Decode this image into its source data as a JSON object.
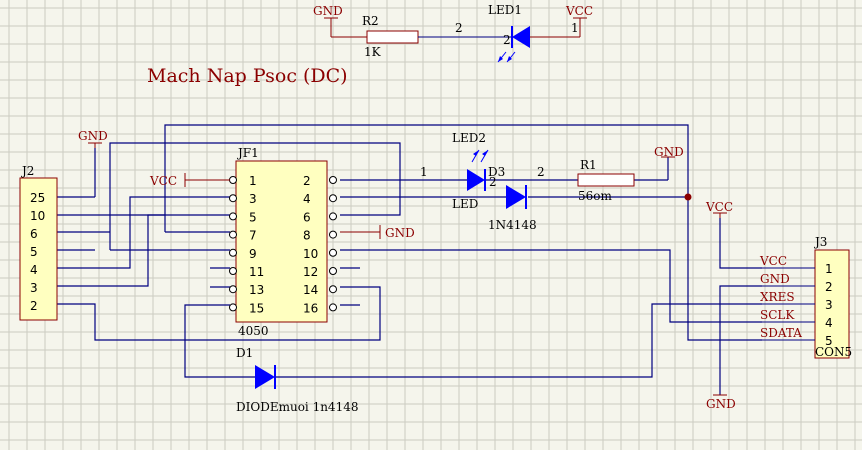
{
  "title": "Mach Nap Psoc (DC)",
  "colors": {
    "wire": "#000080",
    "component": "#8b0000",
    "led": "#0000ff",
    "body_fill": "#ffffc0",
    "grid": "#cbcbc1",
    "background": "#f5f5ec"
  },
  "top_circuit": {
    "gnd": "GND",
    "vcc": "VCC",
    "r2": {
      "ref": "R2",
      "value": "1K"
    },
    "led1": {
      "ref": "LED1",
      "pin_a": "2",
      "pin_b": "1"
    },
    "net_num": "2"
  },
  "j2": {
    "ref": "J2",
    "pins": [
      "25",
      "10",
      "6",
      "5",
      "4",
      "3",
      "2"
    ]
  },
  "jf1": {
    "ref": "JF1",
    "part": "4050",
    "left_pins": [
      "1",
      "3",
      "5",
      "7",
      "9",
      "11",
      "13",
      "15"
    ],
    "right_pins": [
      "2",
      "4",
      "6",
      "8",
      "10",
      "12",
      "14",
      "16"
    ]
  },
  "power_labels": {
    "vcc_jf1": "VCC",
    "gnd_jf1": "GND",
    "gnd_j2": "GND",
    "gnd_r1": "GND",
    "vcc_j3": "VCC",
    "gnd_j3": "GND"
  },
  "led2": {
    "ref": "LED2",
    "value": "LED",
    "net": "1",
    "pin2": "2"
  },
  "d3": {
    "ref": "D3",
    "value": "1N4148",
    "net": "2"
  },
  "r1": {
    "ref": "R1",
    "value": "56om"
  },
  "d1": {
    "ref": "D1",
    "value": "DIODEmuoi 1n4148"
  },
  "j3": {
    "ref": "J3",
    "part": "CON5",
    "pins": [
      "1",
      "2",
      "3",
      "4",
      "5"
    ],
    "signals": [
      "VCC",
      "GND",
      "XRES",
      "SCLK",
      "SDATA"
    ]
  }
}
